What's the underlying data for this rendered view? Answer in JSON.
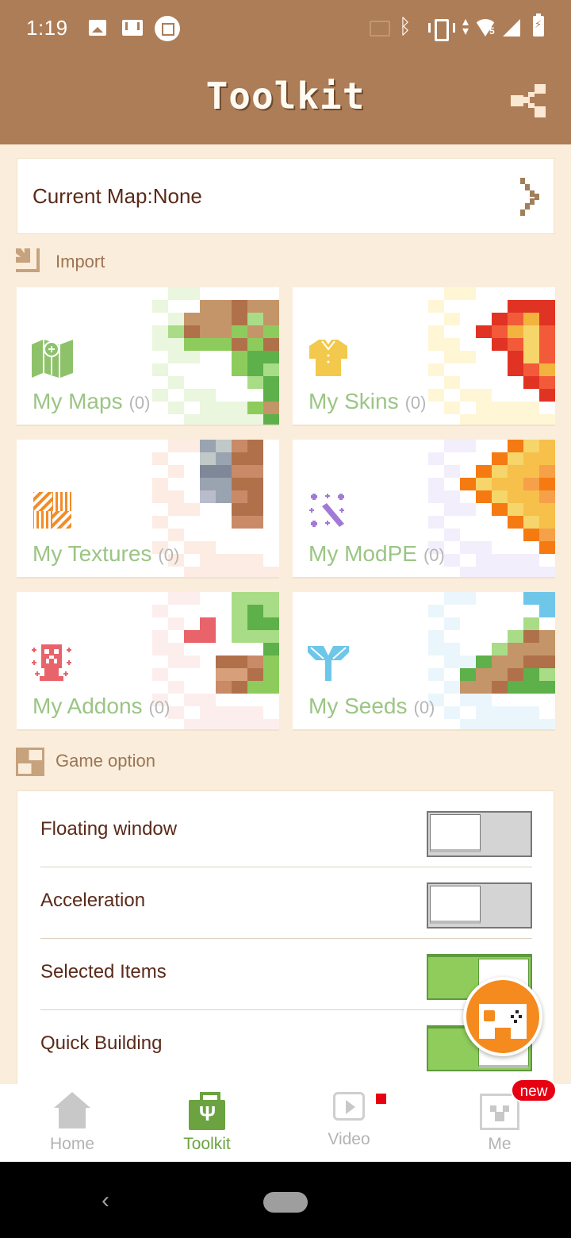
{
  "status_bar": {
    "time": "1:19",
    "left_icons": [
      "image-icon",
      "gmail-icon",
      "screenshot-crop-icon"
    ],
    "right_icons": [
      "cast-icon",
      "bluetooth-icon",
      "vibrate-icon",
      "data-arrows-icon",
      "wifi-icon",
      "signal-icon",
      "battery-charging-icon"
    ],
    "wifi_badge": "5"
  },
  "app_bar": {
    "title": "Toolkit",
    "share_icon": "share-icon",
    "color": "#ad7d57"
  },
  "current_map": {
    "label": "Current Map:None",
    "chevron_icon": "chevron-right-icon"
  },
  "import_section": {
    "title": "Import",
    "icon": "import-icon",
    "tiles": [
      {
        "label": "My Maps",
        "count": "(0)",
        "icon": "map-icon",
        "accent": "#8dc26a"
      },
      {
        "label": "My Skins",
        "count": "(0)",
        "icon": "shirt-icon",
        "accent": "#f2c94c"
      },
      {
        "label": "My Textures",
        "count": "(0)",
        "icon": "texture-icon",
        "accent": "#f28c28"
      },
      {
        "label": "My ModPE",
        "count": "(0)",
        "icon": "magic-wand-icon",
        "accent": "#a27ad6"
      },
      {
        "label": "My Addons",
        "count": "(0)",
        "icon": "creeper-icon",
        "accent": "#e8636a"
      },
      {
        "label": "My Seeds",
        "count": "(0)",
        "icon": "sprout-icon",
        "accent": "#6ec6e8"
      }
    ]
  },
  "game_option_section": {
    "title": "Game option",
    "icon": "toggle-list-icon",
    "options": [
      {
        "label": "Floating window",
        "enabled": false
      },
      {
        "label": "Acceleration",
        "enabled": false
      },
      {
        "label": "Selected Items",
        "enabled": true
      },
      {
        "label": "Quick Building",
        "enabled": true
      }
    ]
  },
  "fab": {
    "icon": "gamepad-icon",
    "color": "#f58a1e"
  },
  "bottom_nav": {
    "items": [
      {
        "label": "Home",
        "icon": "home-icon",
        "active": false
      },
      {
        "label": "Toolkit",
        "icon": "toolkit-icon",
        "active": true
      },
      {
        "label": "Video",
        "icon": "video-icon",
        "active": false,
        "dot": true
      },
      {
        "label": "Me",
        "icon": "creeper-face-icon",
        "active": false,
        "badge": "new"
      }
    ]
  },
  "system_nav": {
    "back_glyph": "‹"
  }
}
